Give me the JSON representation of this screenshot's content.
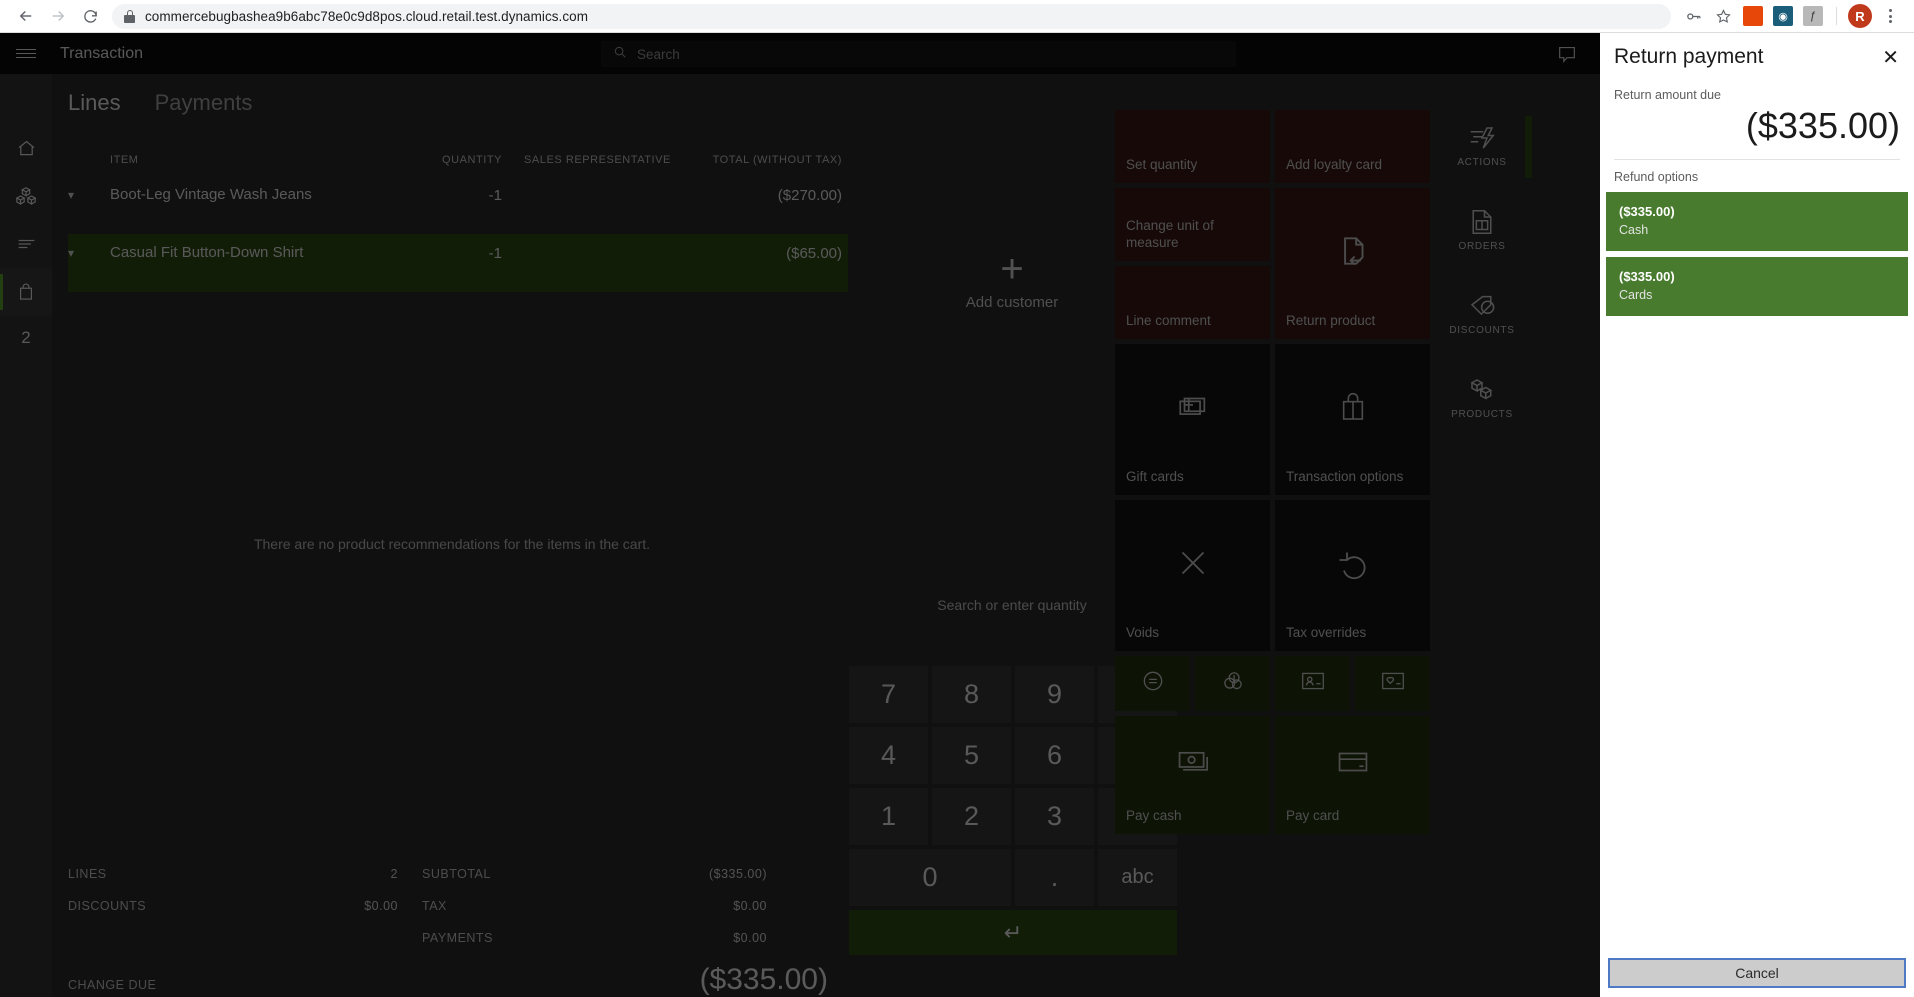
{
  "browser": {
    "back_icon": "back-arrow-icon",
    "forward_icon": "forward-arrow-icon",
    "reload_icon": "reload-icon",
    "url": "commercebugbashea9b6abc78e0c9d8pos.cloud.retail.test.dynamics.com",
    "lock_icon": "lock-icon",
    "key_icon": "password-key-icon",
    "bookmark_icon": "star-icon",
    "ext_office_label": "",
    "profile_initial": "R",
    "menu_icon": "kebab-menu-icon"
  },
  "pos": {
    "header": {
      "menu_icon": "hamburger-menu-icon",
      "title": "Transaction",
      "search_placeholder": "Search",
      "search_icon": "search-icon",
      "icons": [
        "message-icon",
        "sync-icon",
        "gear-icon"
      ]
    },
    "left_rail": {
      "items": [
        {
          "icon": "home-icon",
          "name": "home"
        },
        {
          "icon": "cubes-icon",
          "name": "inventory"
        },
        {
          "icon": "list-icon",
          "name": "list"
        },
        {
          "icon": "bag-icon",
          "name": "cart",
          "active": true
        }
      ],
      "count": "2"
    },
    "cart": {
      "tabs": [
        {
          "label": "Lines",
          "active": true
        },
        {
          "label": "Payments",
          "active": false
        }
      ],
      "columns": {
        "item": "ITEM",
        "quantity": "QUANTITY",
        "sales_rep": "SALES REPRESENTATIVE",
        "total": "TOTAL (WITHOUT TAX)"
      },
      "rows": [
        {
          "caret": "chevron-down-icon",
          "item": "Boot-Leg Vintage Wash Jeans",
          "quantity": "-1",
          "sales_rep": "",
          "total": "($270.00)",
          "selected": false
        },
        {
          "caret": "chevron-down-icon",
          "item": "Casual Fit Button-Down Shirt",
          "quantity": "-1",
          "sales_rep": "",
          "total": "($65.00)",
          "selected": true
        }
      ],
      "recommendation_message": "There are no product recommendations for the items in the cart."
    },
    "totals": {
      "lines_label": "LINES",
      "lines_value": "2",
      "discounts_label": "DISCOUNTS",
      "discounts_value": "$0.00",
      "subtotal_label": "SUBTOTAL",
      "subtotal_value": "($335.00)",
      "tax_label": "TAX",
      "tax_value": "$0.00",
      "payments_label": "PAYMENTS",
      "payments_value": "$0.00",
      "change_due_label": "CHANGE DUE",
      "change_due_value": "($335.00)"
    },
    "customer": {
      "add_icon": "plus-icon",
      "add_label": "Add customer"
    },
    "keypad": {
      "quantity_hint": "Search or enter quantity",
      "keys": [
        {
          "label": "7",
          "name": "key-7"
        },
        {
          "label": "8",
          "name": "key-8"
        },
        {
          "label": "9",
          "name": "key-9"
        },
        {
          "label": "⌫",
          "name": "backspace-key"
        },
        {
          "label": "4",
          "name": "key-4"
        },
        {
          "label": "5",
          "name": "key-5"
        },
        {
          "label": "6",
          "name": "key-6"
        },
        {
          "label": "±",
          "name": "plus-minus-key"
        },
        {
          "label": "1",
          "name": "key-1"
        },
        {
          "label": "2",
          "name": "key-2"
        },
        {
          "label": "3",
          "name": "key-3"
        },
        {
          "label": "*",
          "name": "asterisk-key"
        },
        {
          "label": "0",
          "name": "key-0"
        },
        {
          "label": ".",
          "name": "decimal-key"
        },
        {
          "label": "abc",
          "name": "abc-key"
        }
      ],
      "enter_label": "↵"
    },
    "tiles": [
      {
        "label": "Set quantity",
        "style": "red",
        "size": "sm",
        "icon": ""
      },
      {
        "label": "Add loyalty card",
        "style": "red",
        "size": "sm",
        "icon": ""
      },
      {
        "label": "Change unit of measure",
        "style": "red",
        "size": "tall",
        "icon": ""
      },
      {
        "label": "Return product",
        "style": "red",
        "size": "big",
        "icon": "return-box-icon"
      },
      {
        "label": "Line comment",
        "style": "red",
        "size": "sm",
        "icon": ""
      },
      {
        "label": "Gift cards",
        "style": "dark",
        "size": "big",
        "icon": "gift-card-icon"
      },
      {
        "label": "Transaction options",
        "style": "dark",
        "size": "big",
        "icon": "shopping-bag-icon"
      },
      {
        "label": "Voids",
        "style": "dark",
        "size": "big",
        "icon": "close-x-icon"
      },
      {
        "label": "Tax overrides",
        "style": "dark",
        "size": "big",
        "icon": "undo-arrow-icon"
      },
      {
        "label": "",
        "style": "green",
        "size": "ico",
        "icon": "no-sale-icon"
      },
      {
        "label": "",
        "style": "green",
        "size": "ico",
        "icon": "currency-coins-icon"
      },
      {
        "label": "",
        "style": "green",
        "size": "ico",
        "icon": "id-card-icon"
      },
      {
        "label": "",
        "style": "green",
        "size": "ico",
        "icon": "loyalty-card-icon"
      },
      {
        "label": "Pay cash",
        "style": "green",
        "size": "pay",
        "icon": "cash-icon"
      },
      {
        "label": "Pay card",
        "style": "green",
        "size": "pay",
        "icon": "credit-card-icon"
      }
    ],
    "right_nav": [
      {
        "label": "ACTIONS",
        "icon": "actions-lightning-icon",
        "active": true
      },
      {
        "label": "ORDERS",
        "icon": "orders-document-icon",
        "active": false
      },
      {
        "label": "DISCOUNTS",
        "icon": "discount-tag-icon",
        "active": false
      },
      {
        "label": "PRODUCTS",
        "icon": "products-cubes-icon",
        "active": false
      }
    ]
  },
  "dialog": {
    "title": "Return payment",
    "close_icon": "close-icon",
    "amount_due_label": "Return amount due",
    "amount_due_value": "($335.00)",
    "refund_options_label": "Refund options",
    "options": [
      {
        "amount": "($335.00)",
        "method": "Cash"
      },
      {
        "amount": "($335.00)",
        "method": "Cards"
      }
    ],
    "cancel_label": "Cancel",
    "accent_green": "#487b2d"
  }
}
